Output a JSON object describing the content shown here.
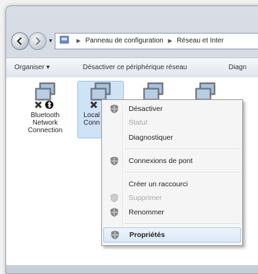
{
  "address_bar": {
    "crumbs": [
      "Panneau de configuration",
      "Réseau et Inter"
    ]
  },
  "toolbar": {
    "organize_label": "Organiser ▾",
    "disable_label": "Désactiver ce périphérique réseau",
    "diag_label": "Diagn"
  },
  "connections": [
    {
      "line1": "Bluetooth",
      "line2": "Network",
      "line3": "Connection"
    },
    {
      "line1": "Local",
      "line2": "Conn"
    }
  ],
  "context_menu": {
    "items": [
      {
        "label": "Désactiver",
        "state": "enabled"
      },
      {
        "label": "Statut",
        "state": "disabled"
      },
      {
        "label": "Diagnostiquer",
        "state": "enabled"
      },
      {
        "label": "Connexions de pont",
        "state": "enabled"
      },
      {
        "label": "Créer un raccourci",
        "state": "enabled"
      },
      {
        "label": "Supprimer",
        "state": "disabled"
      },
      {
        "label": "Renommer",
        "state": "enabled"
      },
      {
        "label": "Propriétés",
        "state": "default-highlighted"
      }
    ]
  },
  "colors": {
    "selection": "#cfe3f7",
    "menu_background": "#f5f5f5",
    "disabled_text": "#a8a8a8"
  },
  "icons": [
    "back-arrow-icon",
    "forward-arrow-icon",
    "control-panel-icon",
    "network-adapter-icon",
    "shield-icon"
  ]
}
